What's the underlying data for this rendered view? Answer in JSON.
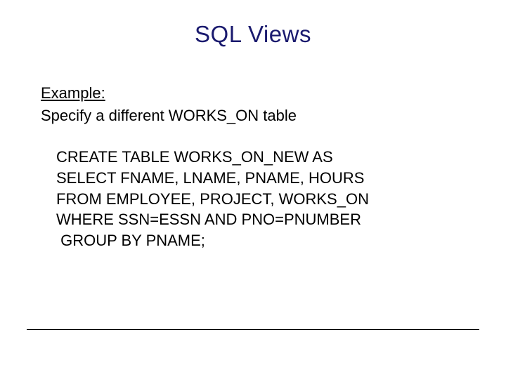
{
  "title": "SQL Views",
  "example_label": "Example:",
  "description": "Specify a different WORKS_ON table",
  "code": {
    "l1": "CREATE TABLE WORKS_ON_NEW AS",
    "l2": "SELECT FNAME, LNAME, PNAME, HOURS",
    "l3": "FROM EMPLOYEE, PROJECT, WORKS_ON",
    "l4": "WHERE SSN=ESSN AND PNO=PNUMBER",
    "l5": " GROUP BY PNAME;"
  }
}
